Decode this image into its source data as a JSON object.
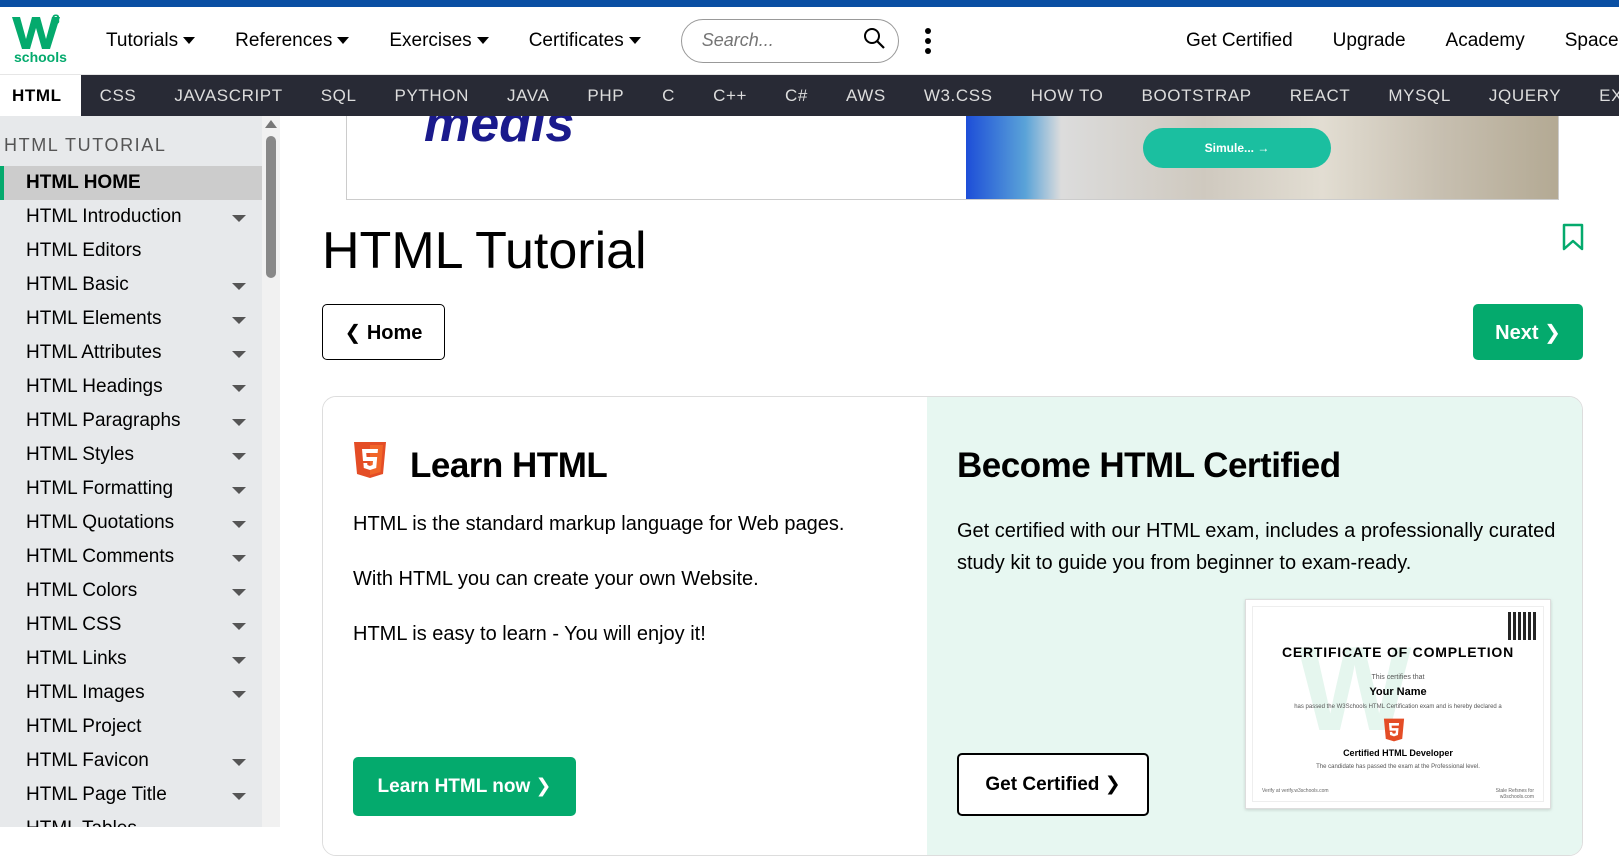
{
  "brand": {
    "logo_sup": "3",
    "logo_text": "schools",
    "accent": "#04AA6D"
  },
  "topnav": {
    "menus": [
      "Tutorials",
      "References",
      "Exercises",
      "Certificates"
    ],
    "search_placeholder": "Search...",
    "right_links": [
      "Get Certified",
      "Upgrade",
      "Academy",
      "Spaces"
    ]
  },
  "subnav": [
    "HTML",
    "CSS",
    "JAVASCRIPT",
    "SQL",
    "PYTHON",
    "JAVA",
    "PHP",
    "C",
    "C++",
    "C#",
    "AWS",
    "W3.CSS",
    "HOW TO",
    "BOOTSTRAP",
    "REACT",
    "MYSQL",
    "JQUERY",
    "EXCEL"
  ],
  "sidebar": {
    "heading": "HTML TUTORIAL",
    "items": [
      {
        "label": "HTML HOME",
        "active": true,
        "expand": false
      },
      {
        "label": "HTML Introduction",
        "expand": true
      },
      {
        "label": "HTML Editors",
        "expand": false
      },
      {
        "label": "HTML Basic",
        "expand": true
      },
      {
        "label": "HTML Elements",
        "expand": true
      },
      {
        "label": "HTML Attributes",
        "expand": true
      },
      {
        "label": "HTML Headings",
        "expand": true
      },
      {
        "label": "HTML Paragraphs",
        "expand": true
      },
      {
        "label": "HTML Styles",
        "expand": true
      },
      {
        "label": "HTML Formatting",
        "expand": true
      },
      {
        "label": "HTML Quotations",
        "expand": true
      },
      {
        "label": "HTML Comments",
        "expand": true
      },
      {
        "label": "HTML Colors",
        "expand": true
      },
      {
        "label": "HTML CSS",
        "expand": true
      },
      {
        "label": "HTML Links",
        "expand": true
      },
      {
        "label": "HTML Images",
        "expand": true
      },
      {
        "label": "HTML Project",
        "expand": false
      },
      {
        "label": "HTML Favicon",
        "expand": true
      },
      {
        "label": "HTML Page Title",
        "expand": true
      },
      {
        "label": "HTML Tables",
        "expand": true
      }
    ]
  },
  "ad": {
    "logo_text": "medis",
    "button_label": "Simule... →"
  },
  "main": {
    "title": "HTML Tutorial",
    "home_button": "❮ Home",
    "next_button": "Next ❯"
  },
  "learn": {
    "heading": "Learn HTML",
    "paragraphs": [
      "HTML is the standard markup language for Web pages.",
      "With HTML you can create your own Website.",
      "HTML is easy to learn - You will enjoy it!"
    ],
    "button": "Learn HTML now ❯"
  },
  "certified": {
    "heading": "Become HTML Certified",
    "description": "Get certified with our HTML exam, includes a professionally curated study kit to guide you from beginner to exam-ready.",
    "button": "Get Certified ❯",
    "certificate": {
      "title": "CERTIFICATE OF COMPLETION",
      "line1": "This certifies that",
      "name": "Your Name",
      "line2": "has passed the W3Schools HTML Certification exam and is hereby declared a",
      "role": "Certified HTML Developer",
      "line3": "The candidate has passed the exam at the Professional level.",
      "footer_left": "Verify at verify.w3schools.com",
      "footer_right": "Stale Refsnes for w3schools.com"
    }
  }
}
